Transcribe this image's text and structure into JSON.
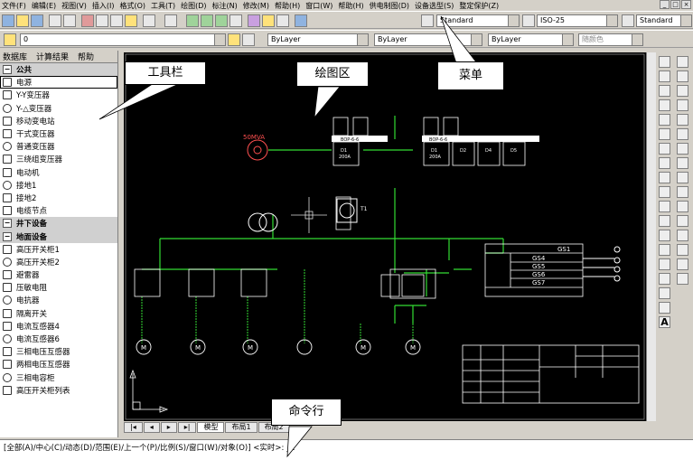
{
  "menu": [
    "文件(F)",
    "编辑(E)",
    "视图(V)",
    "插入(I)",
    "格式(O)",
    "工具(T)",
    "绘图(D)",
    "标注(N)",
    "修改(M)",
    "帮助(H)",
    "窗口(W)",
    "帮助(H)",
    "供电制图(D)",
    "设备选型(S)",
    "整定保护(Z)"
  ],
  "toolbar": {
    "text_style": "Standard",
    "dim_style": "ISO-25",
    "table_style": "Standard",
    "layer": "0",
    "color": "ByLayer",
    "linetype": "ByLayer",
    "lineweight": "ByLayer",
    "plotstyle": "随颜色"
  },
  "window_controls": [
    "_",
    "□",
    "×"
  ],
  "left_panel": {
    "tabs": [
      "数据库",
      "计算结果",
      "帮助"
    ],
    "items": [
      {
        "label": "公共",
        "header": true
      },
      {
        "label": "电源",
        "selected": true
      },
      {
        "label": "Y-Y变压器"
      },
      {
        "label": "Y-△变压器"
      },
      {
        "label": "移动变电站"
      },
      {
        "label": "干式变压器"
      },
      {
        "label": "普通变压器"
      },
      {
        "label": "三绕组变压器"
      },
      {
        "label": "电动机"
      },
      {
        "label": "接地1"
      },
      {
        "label": "接地2"
      },
      {
        "label": "电缆节点"
      },
      {
        "label": "井下设备",
        "header": true
      },
      {
        "label": "地面设备",
        "header": true
      },
      {
        "label": "高压开关柜1"
      },
      {
        "label": "高压开关柜2"
      },
      {
        "label": "避雷器"
      },
      {
        "label": "压敏电阻"
      },
      {
        "label": "电抗器"
      },
      {
        "label": "隔离开关"
      },
      {
        "label": "电流互感器4"
      },
      {
        "label": "电流互感器6"
      },
      {
        "label": "三相电压互感器"
      },
      {
        "label": "两相电压互感器"
      },
      {
        "label": "三相电容柜"
      },
      {
        "label": "高压开关柜列表"
      }
    ]
  },
  "callouts": {
    "toolbar": "工具栏",
    "drawing": "绘图区",
    "menu": "菜单",
    "command": "命令行"
  },
  "drawing": {
    "source": "50MVA",
    "busbars": [
      {
        "label": "BOP-6-6"
      },
      {
        "label": "BOP-6-6"
      }
    ],
    "busboxes": [
      [
        "D1",
        "200A"
      ],
      [
        "D1",
        "200A"
      ],
      [
        "D2"
      ],
      [
        "D4"
      ],
      [
        "D5"
      ]
    ],
    "transformer": "T1",
    "gs_title": "GS1",
    "gs_rows": [
      "GS4",
      "GS5",
      "GS6",
      "GS7"
    ],
    "motor": "M"
  },
  "layout_tabs": [
    "模型",
    "布局1",
    "布局2"
  ],
  "command_text": "[全部(A)/中心(C)/动态(D)/范围(E)/上一个(P)/比例(S)/窗口(W)/对象(O)] <实时>: _e"
}
